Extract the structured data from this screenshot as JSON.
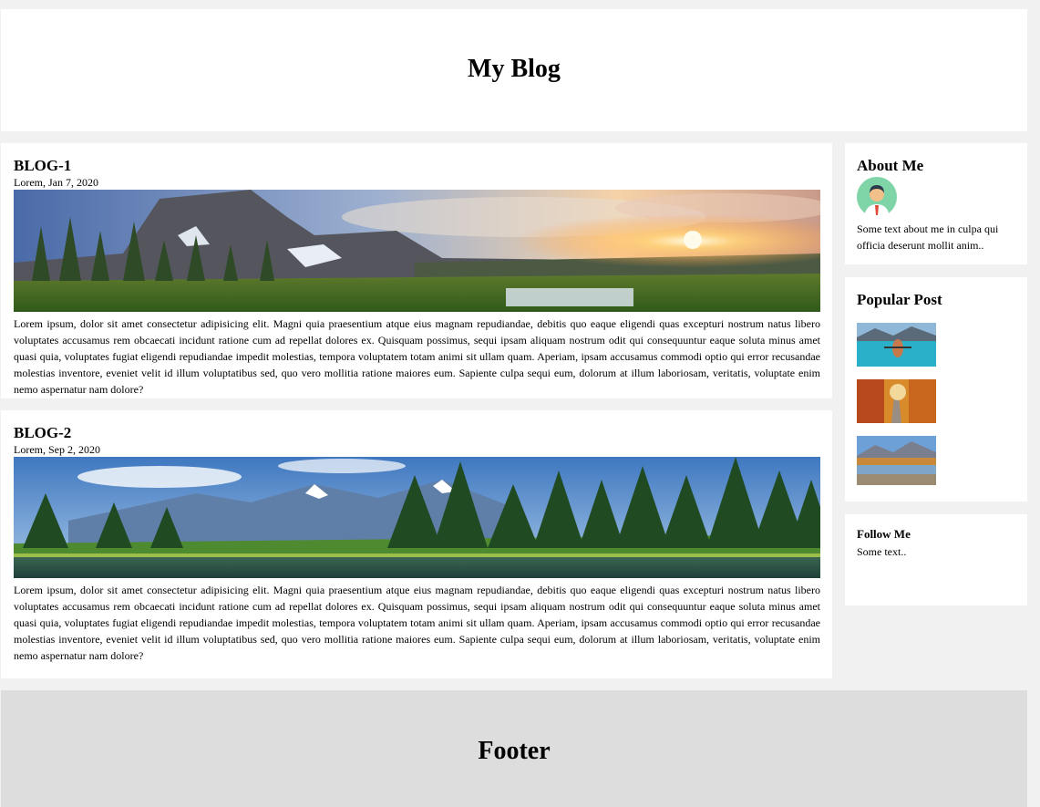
{
  "header": {
    "title": "My Blog"
  },
  "posts": [
    {
      "title": "BLOG-1",
      "date": "Lorem, Jan 7, 2020",
      "image": "mountain-sunrise-landscape",
      "body": "Lorem ipsum, dolor sit amet consectetur adipisicing elit. Magni quia praesentium atque eius magnam repudiandae, debitis quo eaque eligendi quas excepturi nostrum natus libero voluptates accusamus rem obcaecati incidunt ratione cum ad repellat dolores ex. Quisquam possimus, sequi ipsam aliquam nostrum odit qui consequuntur eaque soluta minus amet quasi quia, voluptates fugiat eligendi repudiandae impedit molestias, tempora voluptatem totam animi sit ullam quam. Aperiam, ipsam accusamus commodi optio qui error recusandae molestias inventore, eveniet velit id illum voluptatibus sed, quo vero mollitia ratione maiores eum. Sapiente culpa sequi eum, dolorum at illum laboriosam, veritatis, voluptate enim nemo aspernatur nam dolore?"
    },
    {
      "title": "BLOG-2",
      "date": "Lorem, Sep 2, 2020",
      "image": "forest-lake-landscape",
      "body": "Lorem ipsum, dolor sit amet consectetur adipisicing elit. Magni quia praesentium atque eius magnam repudiandae, debitis quo eaque eligendi quas excepturi nostrum natus libero voluptates accusamus rem obcaecati incidunt ratione cum ad repellat dolores ex. Quisquam possimus, sequi ipsam aliquam nostrum odit qui consequuntur eaque soluta minus amet quasi quia, voluptates fugiat eligendi repudiandae impedit molestias, tempora voluptatem totam animi sit ullam quam. Aperiam, ipsam accusamus commodi optio qui error recusandae molestias inventore, eveniet velit id illum voluptatibus sed, quo vero mollitia ratione maiores eum. Sapiente culpa sequi eum, dolorum at illum laboriosam, veritatis, voluptate enim nemo aspernatur nam dolore?"
    }
  ],
  "sidebar": {
    "about": {
      "title": "About Me",
      "avatar": "person-avatar-icon",
      "text": "Some text about me in culpa qui officia deserunt mollit anim.."
    },
    "popular": {
      "title": "Popular Post",
      "thumbnails": [
        "kayak-lake-thumbnail",
        "autumn-road-thumbnail",
        "mountain-lake-thumbnail"
      ]
    },
    "follow": {
      "title": "Follow Me",
      "text": "Some text.."
    }
  },
  "footer": {
    "title": "Footer"
  },
  "colors": {
    "page_bg": "#f1f1f1",
    "card_bg": "#ffffff",
    "footer_bg": "#dddddd",
    "avatar_bg": "#7fd4a8"
  }
}
